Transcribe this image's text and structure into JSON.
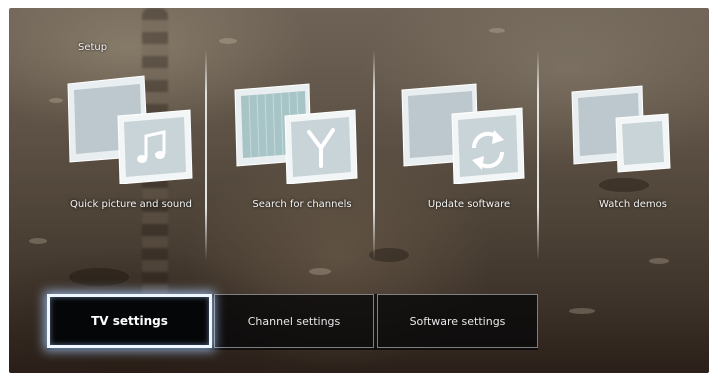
{
  "menu": {
    "title": "Setup",
    "items": [
      {
        "label": "Quick picture and sound",
        "icon": "music-note-icon"
      },
      {
        "label": "Search for channels",
        "icon": "antenna-icon"
      },
      {
        "label": "Update software",
        "icon": "refresh-icon"
      },
      {
        "label": "Watch demos",
        "icon": "screens-icon"
      }
    ]
  },
  "tabs": [
    {
      "label": "TV settings",
      "selected": true
    },
    {
      "label": "Channel settings",
      "selected": false
    },
    {
      "label": "Software settings",
      "selected": false
    }
  ],
  "colors": {
    "tab_highlight": "#aaccff",
    "text": "#f4f4f4",
    "screen_bg": "#4e4337"
  }
}
